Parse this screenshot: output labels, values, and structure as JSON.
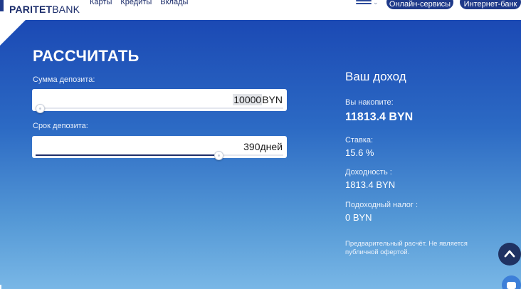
{
  "header": {
    "logo": {
      "bold": "PARITET",
      "light": "BANK"
    },
    "nav": [
      "Карты",
      "Кредиты",
      "Вклады"
    ],
    "buttons": {
      "online": "Онлайн-сервисы",
      "internet": "Интернет-банк"
    }
  },
  "calculator": {
    "title": "РАССЧИТАТЬ",
    "sum": {
      "label": "Сумма депозита:",
      "value": "10000",
      "unit": "BYN",
      "slider_fraction": 0.02
    },
    "term": {
      "label": "Срок депозита:",
      "value": "390",
      "unit": "дней",
      "slider_fraction": 0.74
    }
  },
  "result": {
    "title": "Ваш доход",
    "accumulated": {
      "label": "Вы накопите:",
      "value": "11813.4 BYN"
    },
    "rate": {
      "label": "Ставка:",
      "value": "15.6 %"
    },
    "income": {
      "label": "Доходность :",
      "value": "1813.4 BYN"
    },
    "tax": {
      "label": "Подоходный налог :",
      "value": "0 BYN"
    },
    "note": "Предварительный расчёт. Не является публичной офертой."
  },
  "colors": {
    "brand": "#1f3a8a",
    "hero_top": "#1b49b4",
    "hero_bottom": "#79b7e6",
    "slider_fill": "#1f2f6a"
  },
  "icons": {
    "menu": "menu-icon",
    "chevron": "chevron-down-icon",
    "scroll": "chevron-up-icon",
    "chat": "chat-icon"
  }
}
